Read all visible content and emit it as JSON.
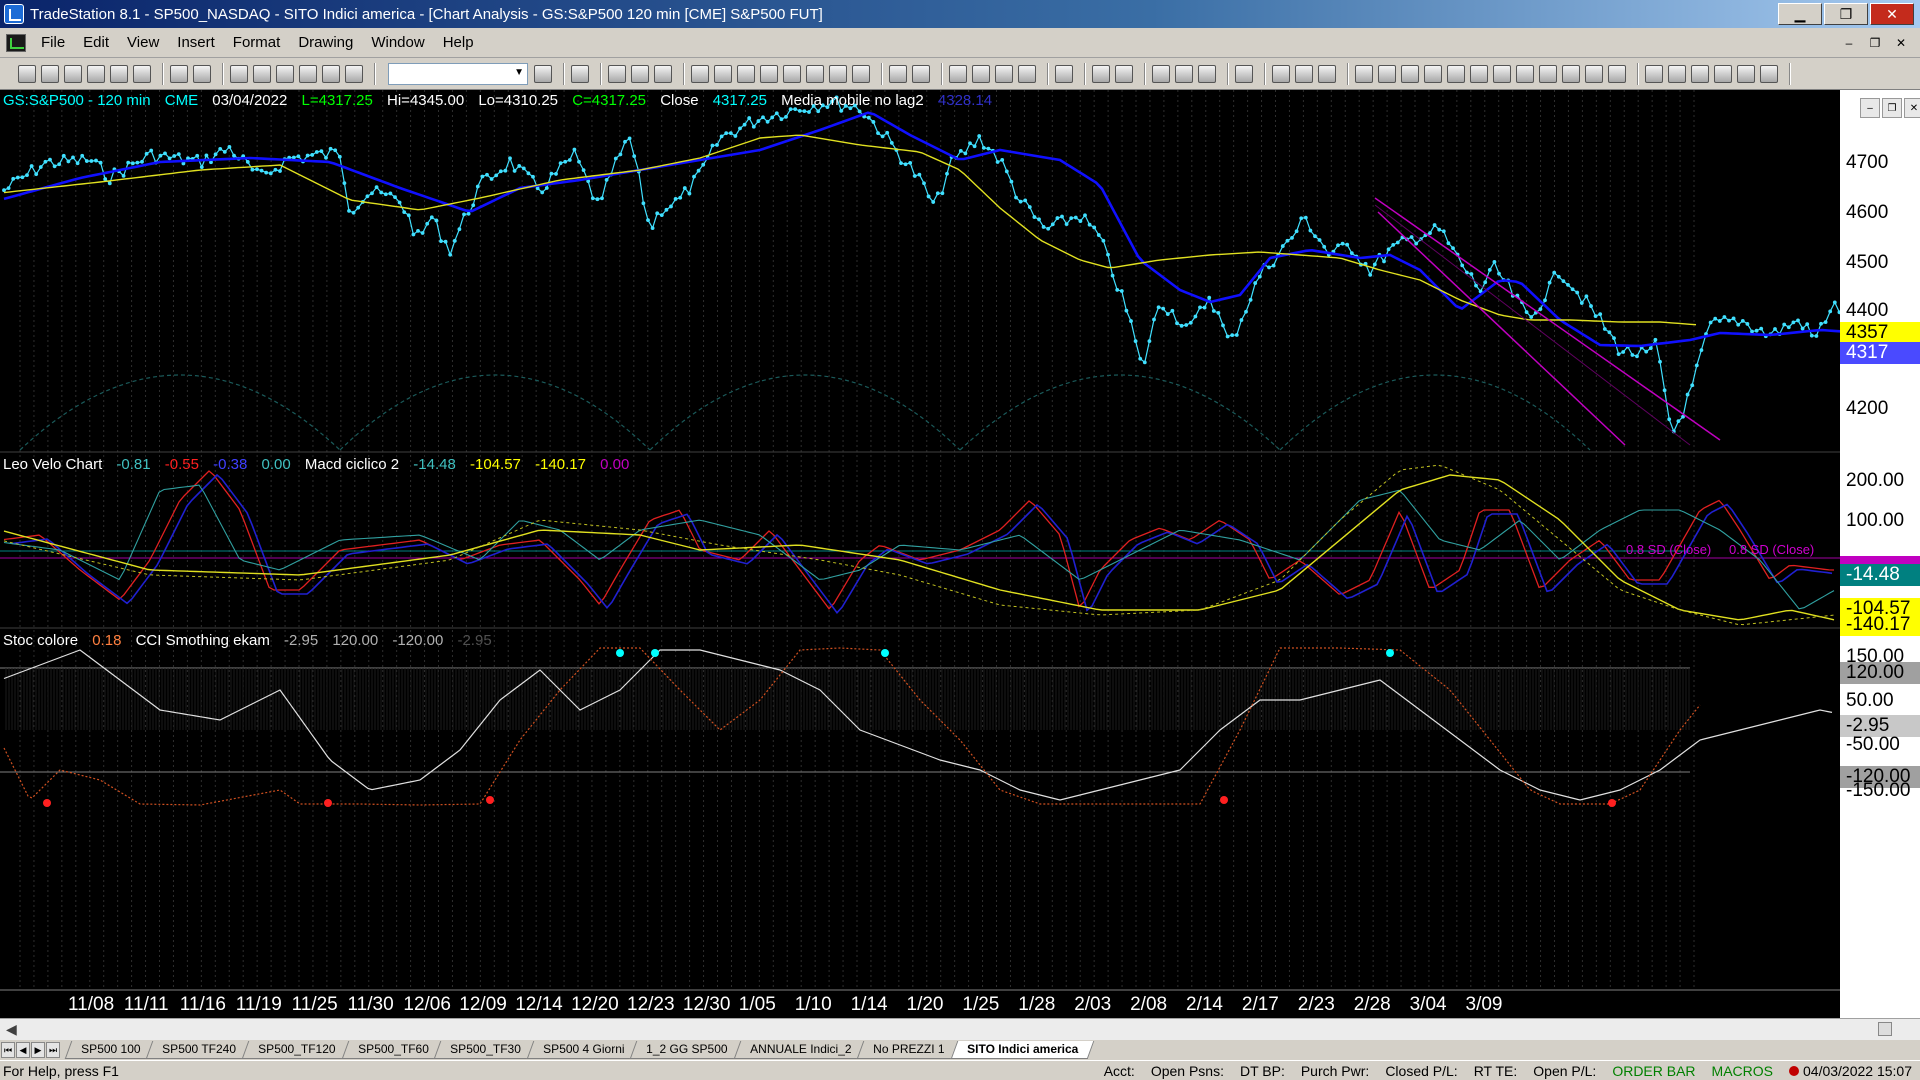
{
  "window": {
    "title": "TradeStation 8.1 - SP500_NASDAQ - SITO Indici america - [Chart Analysis - GS:S&P500  120 min  [CME] S&P500 FUT]"
  },
  "menu": [
    "File",
    "Edit",
    "View",
    "Insert",
    "Format",
    "Drawing",
    "Window",
    "Help"
  ],
  "toolbar": {
    "combo_value": ""
  },
  "price_pane": {
    "symbol": "GS:S&P500 - 120 min",
    "exchange": "CME",
    "date": "03/04/2022",
    "last": "L=4317.25",
    "high": "Hi=4345.00",
    "low": "Lo=4310.25",
    "close": "C=4317.25",
    "close_label": "Close",
    "close_value": "4317.25",
    "indicator_name": "Media mobile no lag2",
    "indicator_value": "4328.14",
    "axis_labels": [
      "4700",
      "4600",
      "4500",
      "4400",
      "4200"
    ],
    "tag_yellow": "4357",
    "tag_blue": "4317",
    "sd_label_1": "0.8 SD (Close)",
    "sd_label_2": "0.8 SD (Close)"
  },
  "macd_pane": {
    "name": "Leo Velo Chart",
    "v1": "-0.81",
    "v2": "-0.55",
    "v3": "-0.38",
    "v4": "0.00",
    "name2": "Macd ciclico 2",
    "v5": "-14.48",
    "v6": "-104.57",
    "v7": "-140.17",
    "v8": "0.00",
    "axis_labels": [
      "200.00",
      "100.00"
    ],
    "tag_teal": "-14.48",
    "tag_yellow_1": "-104.57",
    "tag_yellow_2": "-140.17"
  },
  "stoch_pane": {
    "name": "Stoc colore",
    "v1": "0.18",
    "name2": "CCI Smothing ekam",
    "v2": "-2.95",
    "v3": "120.00",
    "v4": "-120.00",
    "v5": "-2.95",
    "axis_labels": [
      "150.00",
      "50.00",
      "-50.00",
      "-150.00"
    ],
    "tag_120": "120.00",
    "tag_m295": "-2.95",
    "tag_m120": "-120.00"
  },
  "dates": [
    "11/08",
    "11/11",
    "11/16",
    "11/19",
    "11/25",
    "11/30",
    "12/06",
    "12/09",
    "12/14",
    "12/20",
    "12/23",
    "12/30",
    "1/05",
    "1/10",
    "1/14",
    "1/20",
    "1/25",
    "1/28",
    "2/03",
    "2/08",
    "2/14",
    "2/17",
    "2/23",
    "2/28",
    "3/04",
    "3/09"
  ],
  "tabs": [
    "SP500 100",
    "SP500 TF240",
    "SP500_TF120",
    "SP500_TF60",
    "SP500_TF30",
    "SP500 4 Giorni",
    "1_2 GG SP500",
    "ANNUALE Indici_2",
    "No PREZZI 1",
    "SITO Indici america"
  ],
  "status": {
    "help": "For Help, press F1",
    "acct": "Acct:",
    "open_psns": "Open Psns:",
    "dt_bp": "DT BP:",
    "purch_pwr": "Purch Pwr:",
    "closed_pl": "Closed P/L:",
    "rt_te": "RT TE:",
    "open_pl": "Open P/L:",
    "order_bar": "ORDER BAR",
    "macros": "MACROS",
    "datetime": "04/03/2022 15:07"
  },
  "colors": {
    "price": "#40e0ff",
    "ma_blue": "#1010ff",
    "ma_yellow": "#e0e020",
    "channel": "#c000c0",
    "grid": "#3a3a3a"
  }
}
